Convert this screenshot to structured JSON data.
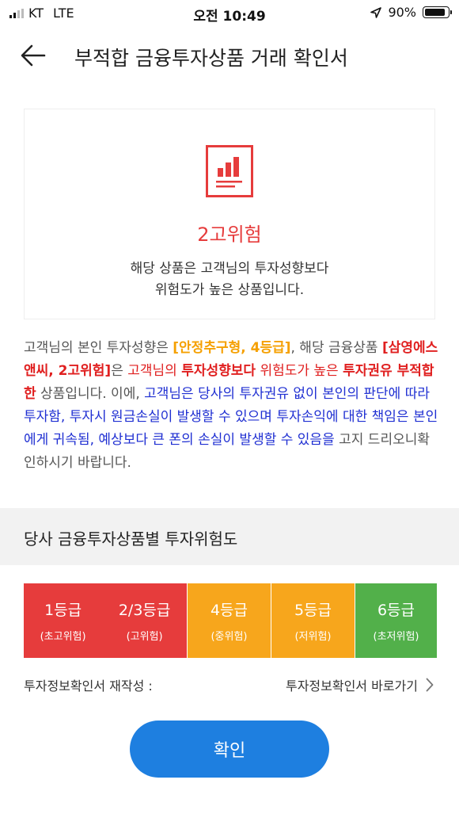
{
  "status_bar": {
    "carrier": "KT",
    "network": "LTE",
    "time": "오전 10:49",
    "battery": "90%"
  },
  "header": {
    "title": "부적합 금융투자상품 거래 확인서"
  },
  "risk_card": {
    "level": "2고위험",
    "desc_line1": "해당 상품은 고객님의 투자성향보다",
    "desc_line2": "위험도가 높은 상품입니다."
  },
  "notice": {
    "p1": "고객님의 본인 투자성향은 ",
    "profile": "[안정추구형, 4등급]",
    "p2": ", 해당 금융상품 ",
    "product": "[삼영에스앤씨, 2고위험]",
    "p3": "은 ",
    "red1": "고객님의 ",
    "red_bold1": "투자성향보다",
    "red2": " 위험도가 높은 ",
    "red_bold2": "투자권유 부적합한",
    "p4": " 상품입니다. 이에, ",
    "blue": "고객님은 당사의 투자권유 없이 본인의 판단에 따라 투자함, 투자시 원금손실이 발생할 수 있으며 투자손익에 대한 책임은 본인에게 귀속됨, 예상보다 큰 폰의 손실이 발생할 수 있음을",
    "p5": " 고지 드리오니확인하시기 바랍니다."
  },
  "section": {
    "title": "당사 금융투자상품별 투자위험도"
  },
  "grades": [
    {
      "label": "1등급",
      "desc": "(초고위험)"
    },
    {
      "label": "2/3등급",
      "desc": "(고위험)"
    },
    {
      "label": "4등급",
      "desc": "(중위험)"
    },
    {
      "label": "5등급",
      "desc": "(저위험)"
    },
    {
      "label": "6등급",
      "desc": "(초저위험)"
    }
  ],
  "colors": {
    "red": "#e63c3c",
    "orange": "#f7a61c",
    "green": "#52b04a",
    "button": "#1e7fe0"
  },
  "footer": {
    "reconfirm_label": "투자정보확인서 재작성 :",
    "shortcut_label": "투자정보확인서 바로가기"
  },
  "confirm_label": "확인"
}
